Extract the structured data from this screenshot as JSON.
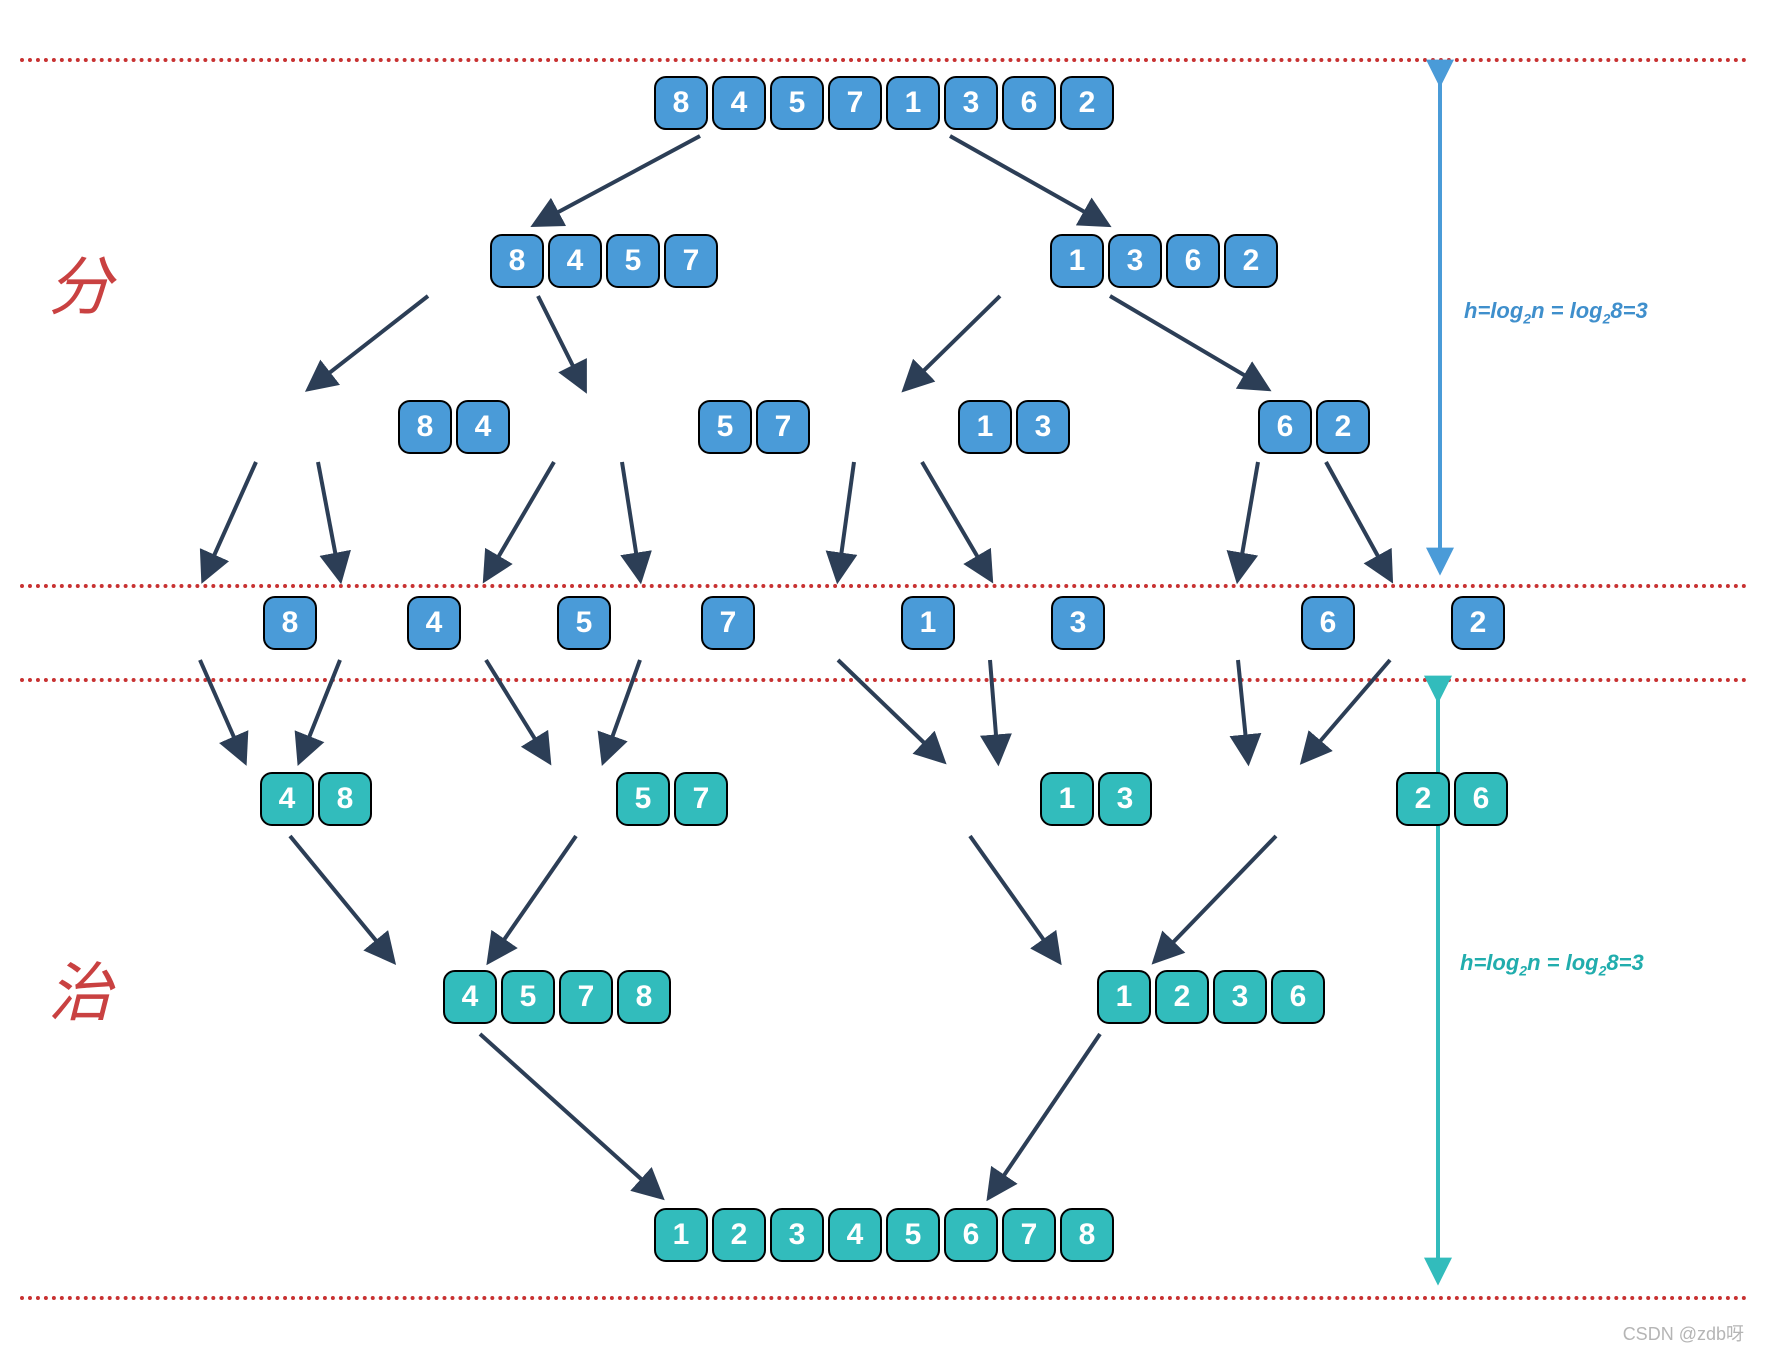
{
  "chart_data": {
    "type": "table",
    "title": "Merge sort divide-and-conquer tree",
    "divide": {
      "label": "分",
      "formula": "h=log₂n = log₂8=3",
      "levels": [
        [
          [
            8,
            4,
            5,
            7,
            1,
            3,
            6,
            2
          ]
        ],
        [
          [
            8,
            4,
            5,
            7
          ],
          [
            1,
            3,
            6,
            2
          ]
        ],
        [
          [
            8,
            4
          ],
          [
            5,
            7
          ],
          [
            1,
            3
          ],
          [
            6,
            2
          ]
        ],
        [
          [
            8
          ],
          [
            4
          ],
          [
            5
          ],
          [
            7
          ],
          [
            1
          ],
          [
            3
          ],
          [
            6
          ],
          [
            2
          ]
        ]
      ]
    },
    "conquer": {
      "label": "治",
      "formula": "h=log₂n = log₂8=3",
      "levels": [
        [
          [
            4,
            8
          ],
          [
            5,
            7
          ],
          [
            1,
            3
          ],
          [
            2,
            6
          ]
        ],
        [
          [
            4,
            5,
            7,
            8
          ],
          [
            1,
            2,
            3,
            6
          ]
        ],
        [
          [
            1,
            2,
            3,
            4,
            5,
            6,
            7,
            8
          ]
        ]
      ]
    }
  },
  "labels": {
    "divide": "分",
    "conquer": "治",
    "formula_html": "h=log<span class='sub'>2</span>n = log<span class='sub'>2</span>8=3"
  },
  "watermark": "CSDN @zdb呀"
}
